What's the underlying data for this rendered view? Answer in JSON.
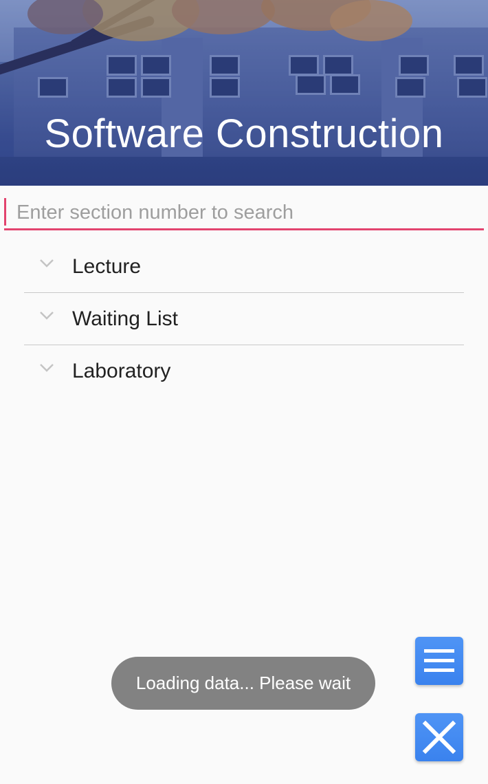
{
  "header": {
    "title": "Software Construction",
    "accent_color": "#e2436e",
    "banner_tint": "#3d5190"
  },
  "search": {
    "value": "",
    "placeholder": "Enter section number to search"
  },
  "sections": [
    {
      "label": "Lecture",
      "icon": "chevron-down-icon",
      "expanded": false
    },
    {
      "label": "Waiting List",
      "icon": "chevron-down-icon",
      "expanded": false
    },
    {
      "label": "Laboratory",
      "icon": "chevron-down-icon",
      "expanded": false
    }
  ],
  "toast": {
    "message": "Loading data... Please wait"
  },
  "fabs": {
    "menu_icon": "menu-icon",
    "close_icon": "close-icon",
    "color": "#4189f1"
  }
}
